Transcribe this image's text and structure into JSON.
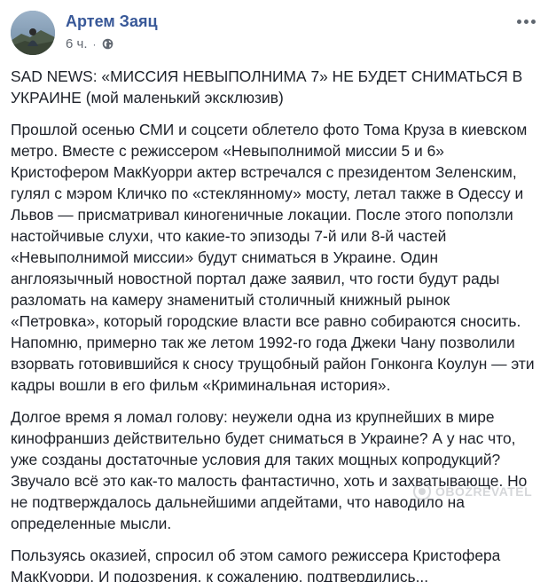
{
  "post": {
    "author": {
      "name": "Артем Заяц",
      "avatar_icon": "profile-photo"
    },
    "meta": {
      "time": "6 ч.",
      "separator": "·",
      "privacy_icon": "globe-icon"
    },
    "more_icon": "more-options-icon",
    "paragraphs": [
      "SAD NEWS: «МИССИЯ НЕВЫПОЛНИМА 7» НЕ БУДЕТ СНИМАТЬСЯ В УКРАИНЕ (мой маленький эксклюзив)",
      "Прошлой осенью СМИ и соцсети облетело фото Тома Круза в киевском метро. Вместе с режиссером «Невыполнимой миссии 5 и 6» Кристофером МакКуорри актер встречался с президентом Зеленским, гулял с мэром Кличко по «стеклянному» мосту, летал также в Одессу и Львов — присматривал киногеничные локации. После этого поползли настойчивые слухи, что какие-то эпизоды 7-й или 8-й частей «Невыполнимой миссии» будут сниматься в Украине. Один англоязычный новостной портал даже заявил, что гости будут рады разломать на камеру знаменитый столичный книжный рынок «Петровка», который городские власти все равно собираются сносить. Напомню, примерно так же летом 1992-го года Джеки Чану позволили взорвать готовившийся к сносу трущобный район Гонконга Коулун — эти кадры вошли в его фильм «Криминальная история».",
      "Долгое время я ломал голову: неужели одна из крупнейших в мире кинофраншиз действительно будет сниматься в Украине? А у нас что, уже созданы достаточные условия для таких мощных копродукций? Звучало всё это как-то малость фантастично, хоть и захватывающе. Но не подтверждалось дальнейшими апдейтами, что наводило на определенные мысли.",
      "Пользуясь оказией, спросил об этом самого режиссера Кристофера МакКуорри. И подозрения, к сожалению, подтвердились..."
    ]
  },
  "watermark": {
    "text": "OBOZREVATEL"
  },
  "colors": {
    "author_link": "#385898",
    "body_text": "#1d2129",
    "meta_text": "#616770",
    "background": "#ffffff"
  }
}
